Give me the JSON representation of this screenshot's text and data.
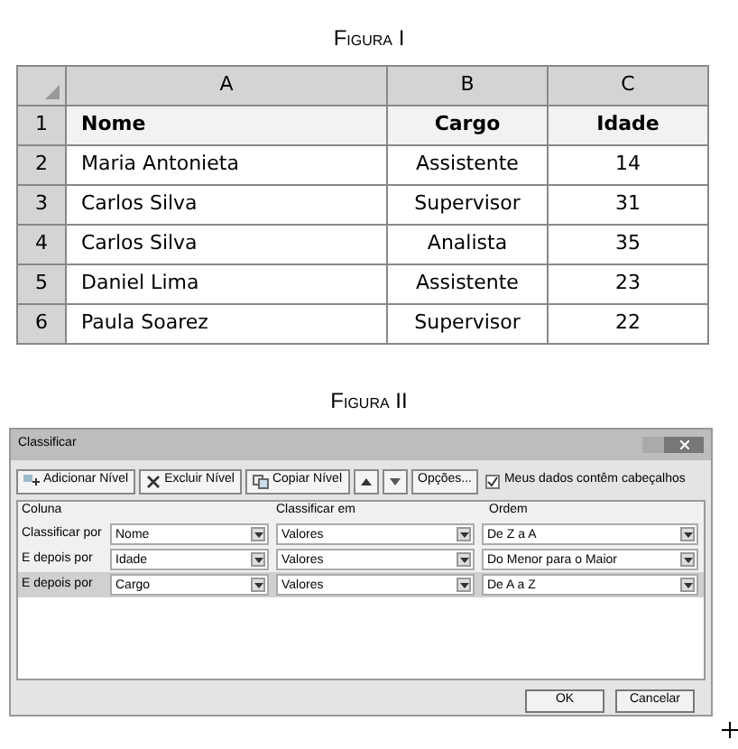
{
  "figure_1": {
    "caption": "Figura I",
    "columns": [
      "A",
      "B",
      "C"
    ],
    "rows": [
      {
        "number": "1",
        "header": true,
        "cells": [
          "Nome",
          "Cargo",
          "Idade"
        ]
      },
      {
        "number": "2",
        "header": false,
        "cells": [
          "Maria Antonieta",
          "Assistente",
          "14"
        ]
      },
      {
        "number": "3",
        "header": false,
        "cells": [
          "Carlos Silva",
          "Supervisor",
          "31"
        ]
      },
      {
        "number": "4",
        "header": false,
        "cells": [
          "Carlos Silva",
          "Analista",
          "35"
        ]
      },
      {
        "number": "5",
        "header": false,
        "cells": [
          "Daniel Lima",
          "Assistente",
          "23"
        ]
      },
      {
        "number": "6",
        "header": false,
        "cells": [
          "Paula Soarez",
          "Supervisor",
          "22"
        ]
      }
    ]
  },
  "figure_2": {
    "caption": "Figura II",
    "dialog": {
      "title": "Classificar",
      "toolbar": [
        {
          "kind": "add",
          "label": "Adicionar Nível"
        },
        {
          "kind": "delete",
          "label": "Excluir Nível"
        },
        {
          "kind": "copy",
          "label": "Copiar Nível"
        },
        {
          "kind": "up"
        },
        {
          "kind": "down"
        },
        {
          "kind": "text",
          "label": "Opções..."
        }
      ],
      "headers_checkbox": {
        "label": "Meus dados contêm cabeçalhos",
        "checked": true
      },
      "columns": [
        "Coluna",
        "Classificar em",
        "Ordem"
      ],
      "levels": [
        {
          "label": "Classificar por",
          "column": "Nome",
          "sort_on": "Valores",
          "order": "De Z a A",
          "selected": false
        },
        {
          "label": "E depois por",
          "column": "Idade",
          "sort_on": "Valores",
          "order": "Do Menor para o Maior",
          "selected": false
        },
        {
          "label": "E depois por",
          "column": "Cargo",
          "sort_on": "Valores",
          "order": "De A a Z",
          "selected": true
        }
      ],
      "buttons": [
        "OK",
        "Cancelar"
      ]
    }
  }
}
